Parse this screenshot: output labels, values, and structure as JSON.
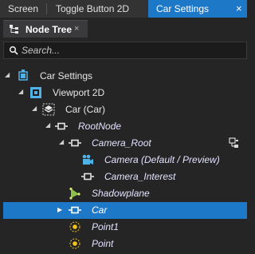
{
  "tabs": [
    {
      "label": "Screen"
    },
    {
      "label": "Toggle Button 2D"
    },
    {
      "label": "Car Settings",
      "active": true,
      "close": "×"
    }
  ],
  "panel": {
    "title": "Node Tree",
    "close": "×"
  },
  "search": {
    "placeholder": "Search..."
  },
  "tree": [
    {
      "label": "Car Settings",
      "icon": "screen-icon",
      "expanded": true
    },
    {
      "label": "Viewport 2D",
      "icon": "viewport-icon",
      "expanded": true
    },
    {
      "label": "Car (Car)",
      "icon": "prefab-icon",
      "expanded": true
    },
    {
      "label": "RootNode",
      "icon": "node-icon",
      "expanded": true
    },
    {
      "label": "Camera_Root",
      "icon": "node-icon",
      "expanded": true,
      "badge": "pin-icon"
    },
    {
      "label": "Camera (Default / Preview)",
      "icon": "camera-icon"
    },
    {
      "label": "Camera_Interest",
      "icon": "node-icon"
    },
    {
      "label": "Shadowplane",
      "icon": "plane-icon"
    },
    {
      "label": "Car",
      "icon": "node-icon",
      "expanded": false,
      "selected": true
    },
    {
      "label": "Point1",
      "icon": "point-icon"
    },
    {
      "label": "Point",
      "icon": "point-icon"
    }
  ],
  "colors": {
    "accent": "#1e78c8",
    "background": "#252526",
    "tabbar": "#333333"
  }
}
